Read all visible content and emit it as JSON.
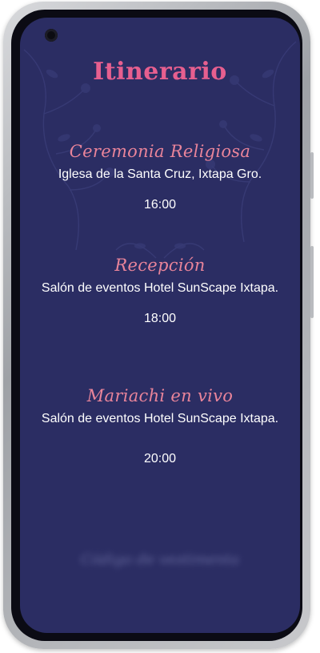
{
  "app": {
    "title": "Itinerario"
  },
  "events": [
    {
      "name": "Ceremonia Religiosa",
      "place": "Iglesa de la Santa Cruz,  Ixtapa Gro.",
      "time": "16:00"
    },
    {
      "name": "Recepción",
      "place": "Salón de eventos  Hotel SunScape Ixtapa.",
      "time": "18:00"
    },
    {
      "name": "Mariachi en vivo",
      "place": "Salón de eventos  Hotel SunScape Ixtapa.",
      "time": "20:00"
    }
  ],
  "footer": {
    "blurred_text": "Código de vestimenta"
  },
  "colors": {
    "background": "#2b2d63",
    "title": "#e75f8f",
    "event_name": "#e9849a",
    "body_text": "#ffffff"
  },
  "icons": {
    "camera": "front-camera-icon",
    "floral": "floral-decoration-icon"
  }
}
